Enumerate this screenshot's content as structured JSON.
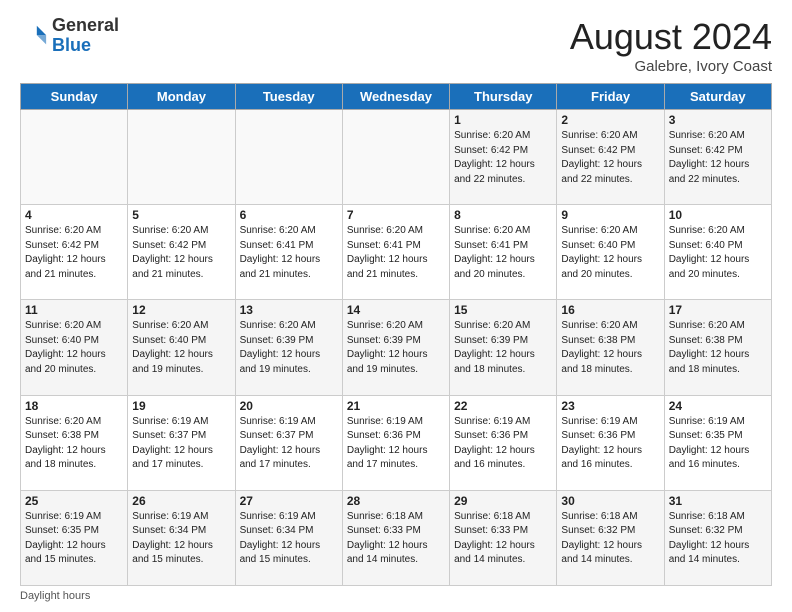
{
  "header": {
    "logo_general": "General",
    "logo_blue": "Blue",
    "month_title": "August 2024",
    "subtitle": "Galebre, Ivory Coast"
  },
  "days_of_week": [
    "Sunday",
    "Monday",
    "Tuesday",
    "Wednesday",
    "Thursday",
    "Friday",
    "Saturday"
  ],
  "weeks": [
    [
      {
        "num": "",
        "info": ""
      },
      {
        "num": "",
        "info": ""
      },
      {
        "num": "",
        "info": ""
      },
      {
        "num": "",
        "info": ""
      },
      {
        "num": "1",
        "info": "Sunrise: 6:20 AM\nSunset: 6:42 PM\nDaylight: 12 hours\nand 22 minutes."
      },
      {
        "num": "2",
        "info": "Sunrise: 6:20 AM\nSunset: 6:42 PM\nDaylight: 12 hours\nand 22 minutes."
      },
      {
        "num": "3",
        "info": "Sunrise: 6:20 AM\nSunset: 6:42 PM\nDaylight: 12 hours\nand 22 minutes."
      }
    ],
    [
      {
        "num": "4",
        "info": "Sunrise: 6:20 AM\nSunset: 6:42 PM\nDaylight: 12 hours\nand 21 minutes."
      },
      {
        "num": "5",
        "info": "Sunrise: 6:20 AM\nSunset: 6:42 PM\nDaylight: 12 hours\nand 21 minutes."
      },
      {
        "num": "6",
        "info": "Sunrise: 6:20 AM\nSunset: 6:41 PM\nDaylight: 12 hours\nand 21 minutes."
      },
      {
        "num": "7",
        "info": "Sunrise: 6:20 AM\nSunset: 6:41 PM\nDaylight: 12 hours\nand 21 minutes."
      },
      {
        "num": "8",
        "info": "Sunrise: 6:20 AM\nSunset: 6:41 PM\nDaylight: 12 hours\nand 20 minutes."
      },
      {
        "num": "9",
        "info": "Sunrise: 6:20 AM\nSunset: 6:40 PM\nDaylight: 12 hours\nand 20 minutes."
      },
      {
        "num": "10",
        "info": "Sunrise: 6:20 AM\nSunset: 6:40 PM\nDaylight: 12 hours\nand 20 minutes."
      }
    ],
    [
      {
        "num": "11",
        "info": "Sunrise: 6:20 AM\nSunset: 6:40 PM\nDaylight: 12 hours\nand 20 minutes."
      },
      {
        "num": "12",
        "info": "Sunrise: 6:20 AM\nSunset: 6:40 PM\nDaylight: 12 hours\nand 19 minutes."
      },
      {
        "num": "13",
        "info": "Sunrise: 6:20 AM\nSunset: 6:39 PM\nDaylight: 12 hours\nand 19 minutes."
      },
      {
        "num": "14",
        "info": "Sunrise: 6:20 AM\nSunset: 6:39 PM\nDaylight: 12 hours\nand 19 minutes."
      },
      {
        "num": "15",
        "info": "Sunrise: 6:20 AM\nSunset: 6:39 PM\nDaylight: 12 hours\nand 18 minutes."
      },
      {
        "num": "16",
        "info": "Sunrise: 6:20 AM\nSunset: 6:38 PM\nDaylight: 12 hours\nand 18 minutes."
      },
      {
        "num": "17",
        "info": "Sunrise: 6:20 AM\nSunset: 6:38 PM\nDaylight: 12 hours\nand 18 minutes."
      }
    ],
    [
      {
        "num": "18",
        "info": "Sunrise: 6:20 AM\nSunset: 6:38 PM\nDaylight: 12 hours\nand 18 minutes."
      },
      {
        "num": "19",
        "info": "Sunrise: 6:19 AM\nSunset: 6:37 PM\nDaylight: 12 hours\nand 17 minutes."
      },
      {
        "num": "20",
        "info": "Sunrise: 6:19 AM\nSunset: 6:37 PM\nDaylight: 12 hours\nand 17 minutes."
      },
      {
        "num": "21",
        "info": "Sunrise: 6:19 AM\nSunset: 6:36 PM\nDaylight: 12 hours\nand 17 minutes."
      },
      {
        "num": "22",
        "info": "Sunrise: 6:19 AM\nSunset: 6:36 PM\nDaylight: 12 hours\nand 16 minutes."
      },
      {
        "num": "23",
        "info": "Sunrise: 6:19 AM\nSunset: 6:36 PM\nDaylight: 12 hours\nand 16 minutes."
      },
      {
        "num": "24",
        "info": "Sunrise: 6:19 AM\nSunset: 6:35 PM\nDaylight: 12 hours\nand 16 minutes."
      }
    ],
    [
      {
        "num": "25",
        "info": "Sunrise: 6:19 AM\nSunset: 6:35 PM\nDaylight: 12 hours\nand 15 minutes."
      },
      {
        "num": "26",
        "info": "Sunrise: 6:19 AM\nSunset: 6:34 PM\nDaylight: 12 hours\nand 15 minutes."
      },
      {
        "num": "27",
        "info": "Sunrise: 6:19 AM\nSunset: 6:34 PM\nDaylight: 12 hours\nand 15 minutes."
      },
      {
        "num": "28",
        "info": "Sunrise: 6:18 AM\nSunset: 6:33 PM\nDaylight: 12 hours\nand 14 minutes."
      },
      {
        "num": "29",
        "info": "Sunrise: 6:18 AM\nSunset: 6:33 PM\nDaylight: 12 hours\nand 14 minutes."
      },
      {
        "num": "30",
        "info": "Sunrise: 6:18 AM\nSunset: 6:32 PM\nDaylight: 12 hours\nand 14 minutes."
      },
      {
        "num": "31",
        "info": "Sunrise: 6:18 AM\nSunset: 6:32 PM\nDaylight: 12 hours\nand 14 minutes."
      }
    ]
  ],
  "footer": {
    "note": "Daylight hours"
  },
  "colors": {
    "header_bg": "#1a6fba",
    "header_text": "#ffffff",
    "odd_row_bg": "#f5f5f5",
    "even_row_bg": "#ffffff"
  }
}
